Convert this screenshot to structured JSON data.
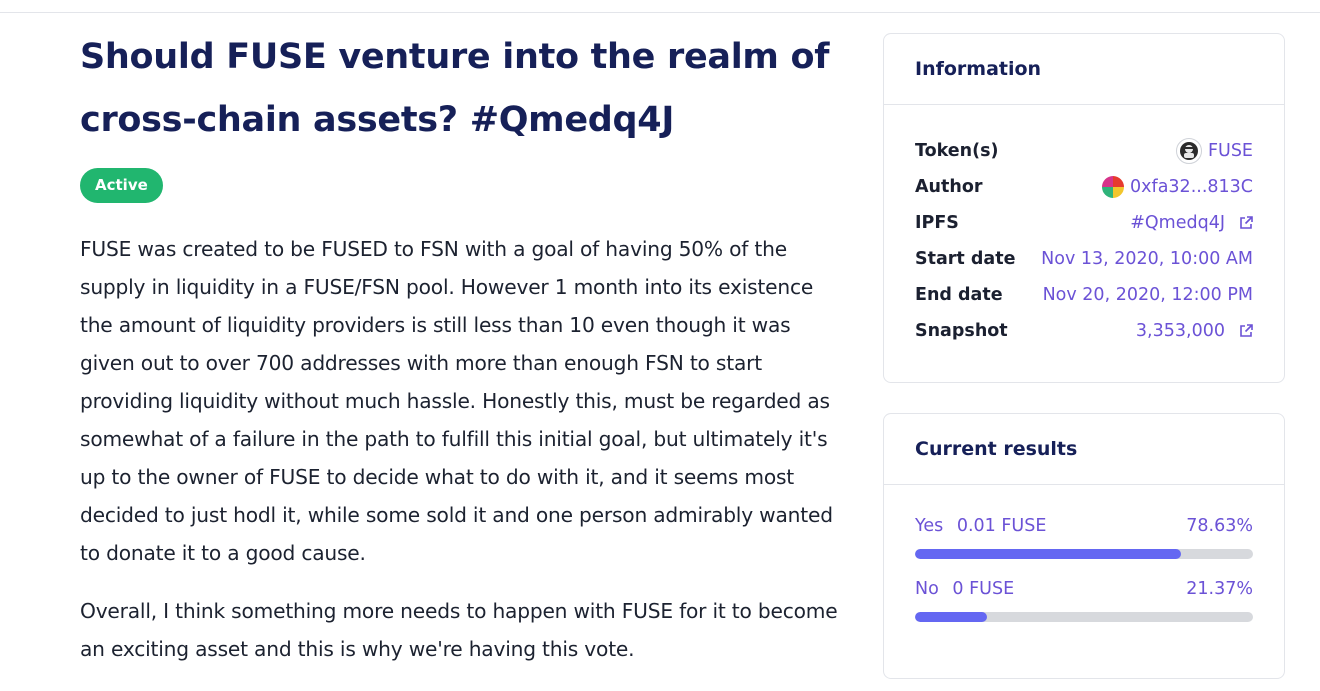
{
  "proposal": {
    "title": "Should FUSE venture into the realm of cross-chain assets? #Qmedq4J",
    "status": "Active",
    "paragraphs": [
      "FUSE was created to be FUSED to FSN with a goal of having 50% of the supply in liquidity in a FUSE/FSN pool. However 1 month into its existence the amount of liquidity providers is still less than 10 even though it was given out to over 700 addresses with more than enough FSN to start providing liquidity without much hassle. Honestly this, must be regarded as somewhat of a failure in the path to fulfill this initial goal, but ultimately it's up to the owner of FUSE to decide what to do with it, and it seems most decided to just hodl it, while some sold it and one person admirably wanted to donate it to a good cause.",
      "Overall, I think something more needs to happen with FUSE for it to become an exciting asset and this is why we're having this vote."
    ]
  },
  "information": {
    "heading": "Information",
    "rows": {
      "tokens": {
        "label": "Token(s)",
        "value": "FUSE"
      },
      "author": {
        "label": "Author",
        "value": "0xfa32...813C"
      },
      "ipfs": {
        "label": "IPFS",
        "value": "#Qmedq4J"
      },
      "start": {
        "label": "Start date",
        "value": "Nov 13, 2020, 10:00 AM"
      },
      "end": {
        "label": "End date",
        "value": "Nov 20, 2020, 12:00 PM"
      },
      "snapshot": {
        "label": "Snapshot",
        "value": "3,353,000"
      }
    }
  },
  "results": {
    "heading": "Current results",
    "options": [
      {
        "choice": "Yes",
        "amount": "0.01 FUSE",
        "percent_label": "78.63%",
        "fraction": 0.7863
      },
      {
        "choice": "No",
        "amount": "0 FUSE",
        "percent_label": "21.37%",
        "fraction": 0.2137
      }
    ]
  },
  "icons": {
    "external_link": "external-link-icon",
    "token_avatar": "fuse-token-avatar",
    "author_avatar": "author-avatar"
  },
  "colors": {
    "title": "#162058",
    "active_badge": "#21b66f",
    "link": "#6b52d6",
    "bar_fill": "#6467f2",
    "bar_track": "#d7d9dd"
  }
}
